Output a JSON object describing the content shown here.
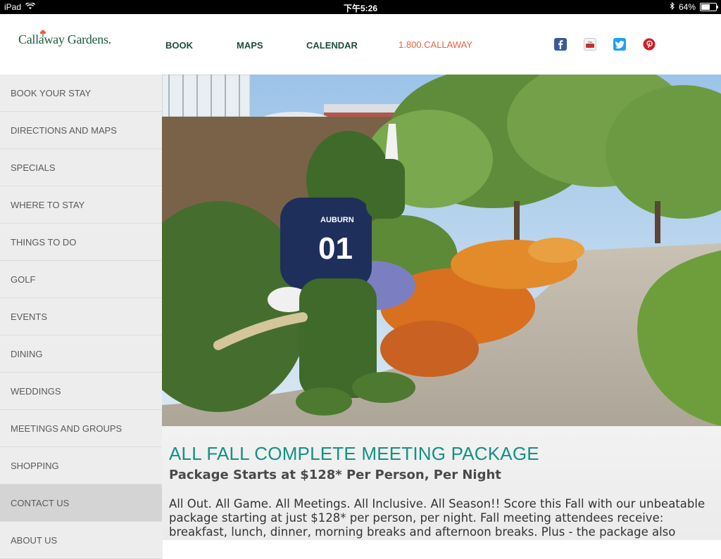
{
  "status_bar": {
    "device": "iPad",
    "time": "下午5:26",
    "battery": "64%",
    "battery_level": 0.64
  },
  "header": {
    "logo_text": "Callaway Gardens.",
    "nav": [
      {
        "label": "BOOK"
      },
      {
        "label": "MAPS"
      },
      {
        "label": "CALENDAR"
      }
    ],
    "phone": "1.800.CALLAWAY",
    "social_icons": [
      "facebook-icon",
      "youtube-icon",
      "twitter-icon",
      "pinterest-icon"
    ]
  },
  "sidebar": {
    "items": [
      {
        "label": "BOOK YOUR STAY"
      },
      {
        "label": "DIRECTIONS AND MAPS"
      },
      {
        "label": "SPECIALS"
      },
      {
        "label": "WHERE TO STAY"
      },
      {
        "label": "THINGS TO DO"
      },
      {
        "label": "GOLF"
      },
      {
        "label": "EVENTS"
      },
      {
        "label": "DINING"
      },
      {
        "label": "WEDDINGS"
      },
      {
        "label": "MEETINGS AND GROUPS"
      },
      {
        "label": "SHOPPING"
      },
      {
        "label": "CONTACT US"
      },
      {
        "label": "ABOUT US"
      }
    ],
    "active_index": 11
  },
  "hero": {
    "jersey_text": "AUBURN",
    "jersey_number": "01"
  },
  "content": {
    "title": "ALL FALL COMPLETE MEETING PACKAGE",
    "subtitle": "Package Starts at $128* Per Person, Per Night",
    "body": "All Out. All Game. All Meetings. All Inclusive. All Season!! Score this Fall with our unbeatable package starting at just $128* per person, per night. Fall meeting attendees receive: breakfast, lunch, dinner, morning breaks and afternoon breaks. Plus - the package also"
  },
  "colors": {
    "title_teal": "#139184",
    "nav_green": "#1d4e3b",
    "phone_orange": "#e8603c",
    "facebook": "#3b5998",
    "youtube": "#c4302b",
    "twitter": "#1da1f2",
    "pinterest": "#cb2027"
  }
}
